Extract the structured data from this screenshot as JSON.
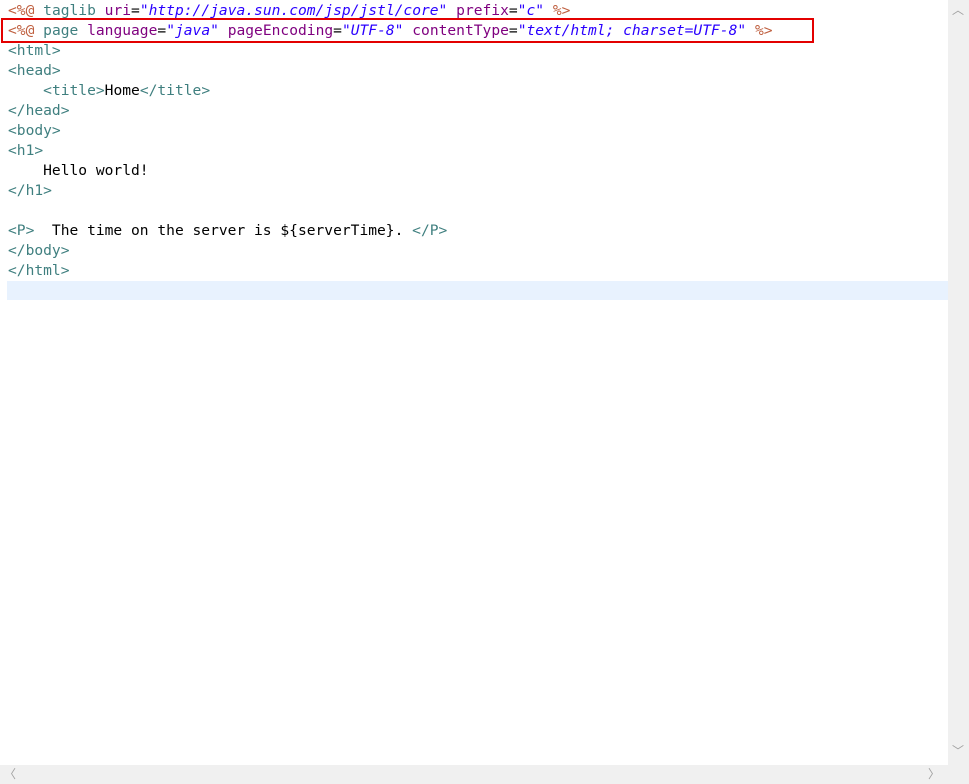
{
  "editor": {
    "lines": [
      {
        "parts": [
          [
            "d",
            "<%@ "
          ],
          [
            "k",
            "taglib "
          ],
          [
            "a",
            "uri"
          ],
          [
            "t",
            "="
          ],
          [
            "s",
            "\"http://java.sun.com/jsp/jstl/core\""
          ],
          [
            "t",
            " "
          ],
          [
            "a",
            "prefix"
          ],
          [
            "t",
            "="
          ],
          [
            "s",
            "\"c\""
          ],
          [
            "t",
            " "
          ],
          [
            "d",
            "%>"
          ]
        ]
      },
      {
        "parts": [
          [
            "d",
            "<%@ "
          ],
          [
            "k",
            "page "
          ],
          [
            "a",
            "language"
          ],
          [
            "t",
            "="
          ],
          [
            "s",
            "\"java\""
          ],
          [
            "t",
            " "
          ],
          [
            "a",
            "pageEncoding"
          ],
          [
            "t",
            "="
          ],
          [
            "s",
            "\"UTF-8\""
          ],
          [
            "t",
            " "
          ],
          [
            "a",
            "contentType"
          ],
          [
            "t",
            "="
          ],
          [
            "s",
            "\"text/html; charset=UTF-8\""
          ],
          [
            "t",
            " "
          ],
          [
            "d",
            "%>"
          ]
        ]
      },
      {
        "parts": [
          [
            "k",
            "<html>"
          ]
        ]
      },
      {
        "parts": [
          [
            "k",
            "<head>"
          ]
        ]
      },
      {
        "parts": [
          [
            "t",
            "    "
          ],
          [
            "k",
            "<title>"
          ],
          [
            "t",
            "Home"
          ],
          [
            "k",
            "</title>"
          ]
        ]
      },
      {
        "parts": [
          [
            "k",
            "</head>"
          ]
        ]
      },
      {
        "parts": [
          [
            "k",
            "<body>"
          ]
        ]
      },
      {
        "parts": [
          [
            "k",
            "<h1>"
          ]
        ]
      },
      {
        "parts": [
          [
            "t",
            "    Hello world!"
          ]
        ]
      },
      {
        "parts": [
          [
            "k",
            "</h1>"
          ]
        ]
      },
      {
        "parts": []
      },
      {
        "parts": [
          [
            "k",
            "<P>"
          ],
          [
            "t",
            "  The time on the server is ${serverTime}. "
          ],
          [
            "k",
            "</P>"
          ]
        ]
      },
      {
        "parts": [
          [
            "k",
            "</body>"
          ]
        ]
      },
      {
        "parts": [
          [
            "k",
            "</html>"
          ]
        ]
      }
    ]
  },
  "scrollbar": {
    "up_arrow": "︿",
    "down_arrow": "﹀",
    "left_arrow": "〈",
    "right_arrow": "〉"
  }
}
